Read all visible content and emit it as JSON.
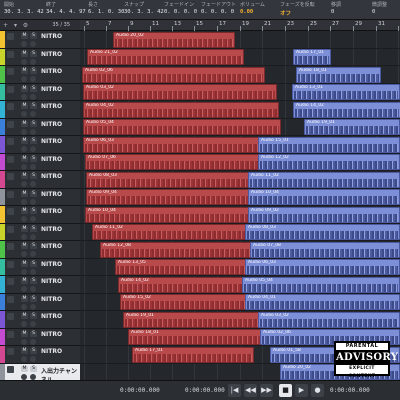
{
  "info_line": {
    "fields": [
      {
        "label": "開始",
        "value": "30. 3. 3. 42"
      },
      {
        "label": "終了",
        "value": "34. 4. 4. 97"
      },
      {
        "label": "長さ",
        "value": "6. 1. 0. 30"
      },
      {
        "label": "スナップ",
        "value": "30. 3. 3. 42"
      },
      {
        "label": "フェードイン",
        "value": "0. 0. 0. 0"
      },
      {
        "label": "フェードアウト",
        "value": "0. 0. 0. 0"
      },
      {
        "label": "ボリューム",
        "value": "0.00"
      },
      {
        "label": "フェーズを反転",
        "value": "オフ"
      },
      {
        "label": "移調",
        "value": "0"
      },
      {
        "label": "微調整",
        "value": "0"
      }
    ]
  },
  "track_list": {
    "count": "35 / 35",
    "tracks": [
      {
        "name": "NITRO",
        "m": "M",
        "s": "S",
        "color": "#f2c230"
      },
      {
        "name": "NITRO",
        "m": "M",
        "s": "S",
        "color": "#c9d32a"
      },
      {
        "name": "NITRO",
        "m": "M",
        "s": "S",
        "color": "#4fc24a"
      },
      {
        "name": "NITRO",
        "m": "M",
        "s": "S",
        "color": "#35bda0"
      },
      {
        "name": "NITRO",
        "m": "M",
        "s": "S",
        "color": "#33b2d6"
      },
      {
        "name": "NITRO",
        "m": "M",
        "s": "S",
        "color": "#3a7fd9"
      },
      {
        "name": "NITRO",
        "m": "M",
        "s": "S",
        "color": "#7b57d6"
      },
      {
        "name": "NITRO",
        "m": "M",
        "s": "S",
        "color": "#c34bd1"
      },
      {
        "name": "NITRO",
        "m": "M",
        "s": "S",
        "color": "#d44892"
      },
      {
        "name": "NITRO",
        "m": "M",
        "s": "S",
        "color": "#8f949c"
      },
      {
        "name": "NITRO",
        "m": "M",
        "s": "S",
        "color": "#f2c230"
      },
      {
        "name": "NITRO",
        "m": "M",
        "s": "S",
        "color": "#c9d32a"
      },
      {
        "name": "NITRO",
        "m": "M",
        "s": "S",
        "color": "#4fc24a"
      },
      {
        "name": "NITRO",
        "m": "M",
        "s": "S",
        "color": "#35bda0"
      },
      {
        "name": "NITRO",
        "m": "M",
        "s": "S",
        "color": "#33b2d6"
      },
      {
        "name": "NITRO",
        "m": "M",
        "s": "S",
        "color": "#3a7fd9"
      },
      {
        "name": "NITRO",
        "m": "M",
        "s": "S",
        "color": "#7b57d6"
      },
      {
        "name": "NITRO",
        "m": "M",
        "s": "S",
        "color": "#c34bd1"
      },
      {
        "name": "NITRO",
        "m": "M",
        "s": "S",
        "color": "#d44892"
      },
      {
        "name": "入出力チャンネル",
        "m": "M",
        "s": "S",
        "color": "#8f949c",
        "selected": true
      }
    ]
  },
  "ruler": {
    "bars": [
      "5",
      "7",
      "9",
      "11",
      "13",
      "15",
      "17",
      "19",
      "21",
      "23",
      "25",
      "27",
      "29",
      "31",
      "33"
    ]
  },
  "events": [
    [
      {
        "name": "Audio 20_02",
        "color": "red"
      }
    ],
    [
      {
        "name": "Audio 21_02",
        "color": "red"
      },
      {
        "name": "Audio 17_01",
        "color": "blue"
      }
    ],
    [
      {
        "name": "Audio 02_06",
        "color": "red"
      },
      {
        "name": "Audio 18_01",
        "color": "blue"
      }
    ],
    [
      {
        "name": "Audio 03_02",
        "color": "red"
      },
      {
        "name": "Audio 13_01",
        "color": "blue"
      }
    ],
    [
      {
        "name": "Audio 04_02",
        "color": "red"
      },
      {
        "name": "Audio 14_02",
        "color": "blue"
      }
    ],
    [
      {
        "name": "Audio 05_04",
        "color": "red"
      },
      {
        "name": "Audio 19_01",
        "color": "blue"
      }
    ],
    [
      {
        "name": "Audio 06_03",
        "color": "red"
      },
      {
        "name": "Audio 15_01",
        "color": "blue"
      }
    ],
    [
      {
        "name": "Audio 07_06",
        "color": "red"
      },
      {
        "name": "Audio 12_02",
        "color": "blue"
      }
    ],
    [
      {
        "name": "Audio 08_03",
        "color": "red"
      },
      {
        "name": "Audio 11_02",
        "color": "blue"
      }
    ],
    [
      {
        "name": "Audio 09_04",
        "color": "red"
      },
      {
        "name": "Audio 10_04",
        "color": "blue"
      }
    ],
    [
      {
        "name": "Audio 10_04",
        "color": "red"
      },
      {
        "name": "Audio 09_02",
        "color": "blue"
      }
    ],
    [
      {
        "name": "Audio 11_02",
        "color": "red"
      },
      {
        "name": "Audio 08_03",
        "color": "blue"
      }
    ],
    [
      {
        "name": "Audio 12_08",
        "color": "red"
      },
      {
        "name": "Audio 07_08",
        "color": "blue"
      }
    ],
    [
      {
        "name": "Audio 13_05",
        "color": "red"
      },
      {
        "name": "Audio 06_03",
        "color": "blue"
      }
    ],
    [
      {
        "name": "Audio 14_02",
        "color": "red"
      },
      {
        "name": "Audio 05_04",
        "color": "blue"
      }
    ],
    [
      {
        "name": "Audio 15_02",
        "color": "red"
      },
      {
        "name": "Audio 04_01",
        "color": "blue"
      }
    ],
    [
      {
        "name": "Audio 19_01",
        "color": "red"
      },
      {
        "name": "Audio 03_02",
        "color": "blue"
      }
    ],
    [
      {
        "name": "Audio 18_01",
        "color": "red"
      },
      {
        "name": "Audio 02_06",
        "color": "blue"
      }
    ],
    [
      {
        "name": "Audio 17_01",
        "color": "red"
      },
      {
        "name": "Audio 01_58",
        "color": "blue"
      }
    ],
    [
      {
        "name": "Audio 20_02",
        "color": "blue"
      }
    ]
  ],
  "advisory": {
    "top": "PARENTAL",
    "mid": "ADVISORY",
    "bottom": "EXPLICIT CONTENT"
  },
  "transport": {
    "time_left": "0:00:00.000",
    "time_mid": "0:00:00.000",
    "time_right": "0:00:00.000",
    "time_far": "0:00:00.000"
  },
  "colors": {
    "event_red": "#b84a4c",
    "event_blue": "#7d8fd6",
    "info_accent": "#f2b233"
  }
}
